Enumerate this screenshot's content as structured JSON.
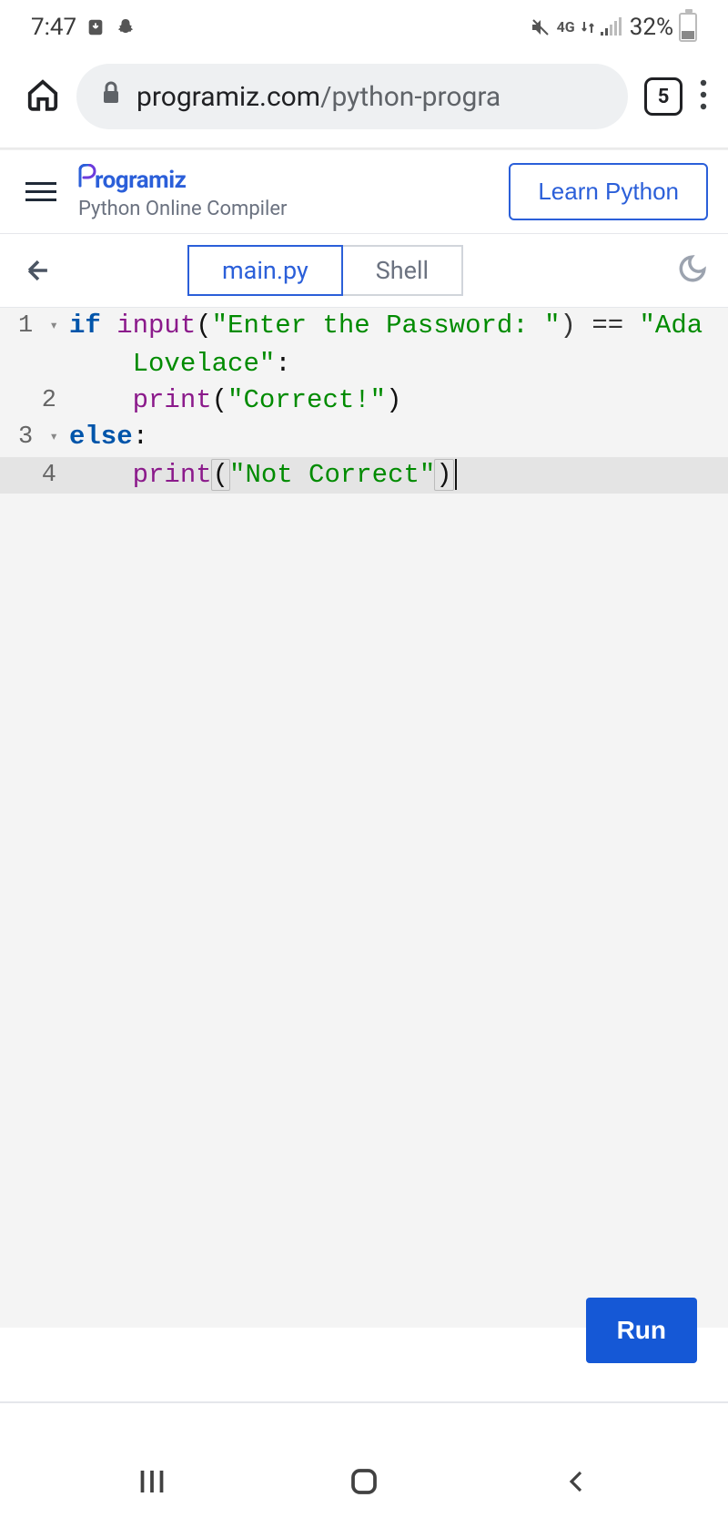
{
  "status_bar": {
    "time": "7:47",
    "network_label": "4G",
    "battery_percent_text": "32%"
  },
  "browser": {
    "url_host": "programiz.com",
    "url_path": "/python-progra",
    "tab_count": "5"
  },
  "site": {
    "logo_text": "rogramiz",
    "subtitle": "Python Online Compiler",
    "learn_button": "Learn Python"
  },
  "tabs": {
    "active": "main.py",
    "inactive": "Shell"
  },
  "editor": {
    "lines": [
      {
        "n": "1",
        "foldable": true,
        "tokens_a": [
          "if",
          " ",
          "input",
          "(",
          "\"Enter the Password: \"",
          ") == ",
          "\"Ada"
        ],
        "tokens_b": [
          "Lovelace\"",
          ":"
        ]
      },
      {
        "n": "2",
        "tokens": [
          "    ",
          "print",
          "(",
          "\"Correct!\"",
          ")"
        ]
      },
      {
        "n": "3",
        "foldable": true,
        "tokens": [
          "else",
          ":"
        ]
      },
      {
        "n": "4",
        "current": true,
        "tokens": [
          "    ",
          "print",
          "(",
          "\"Not Correct\"",
          ")"
        ]
      }
    ]
  },
  "run_button": "Run"
}
